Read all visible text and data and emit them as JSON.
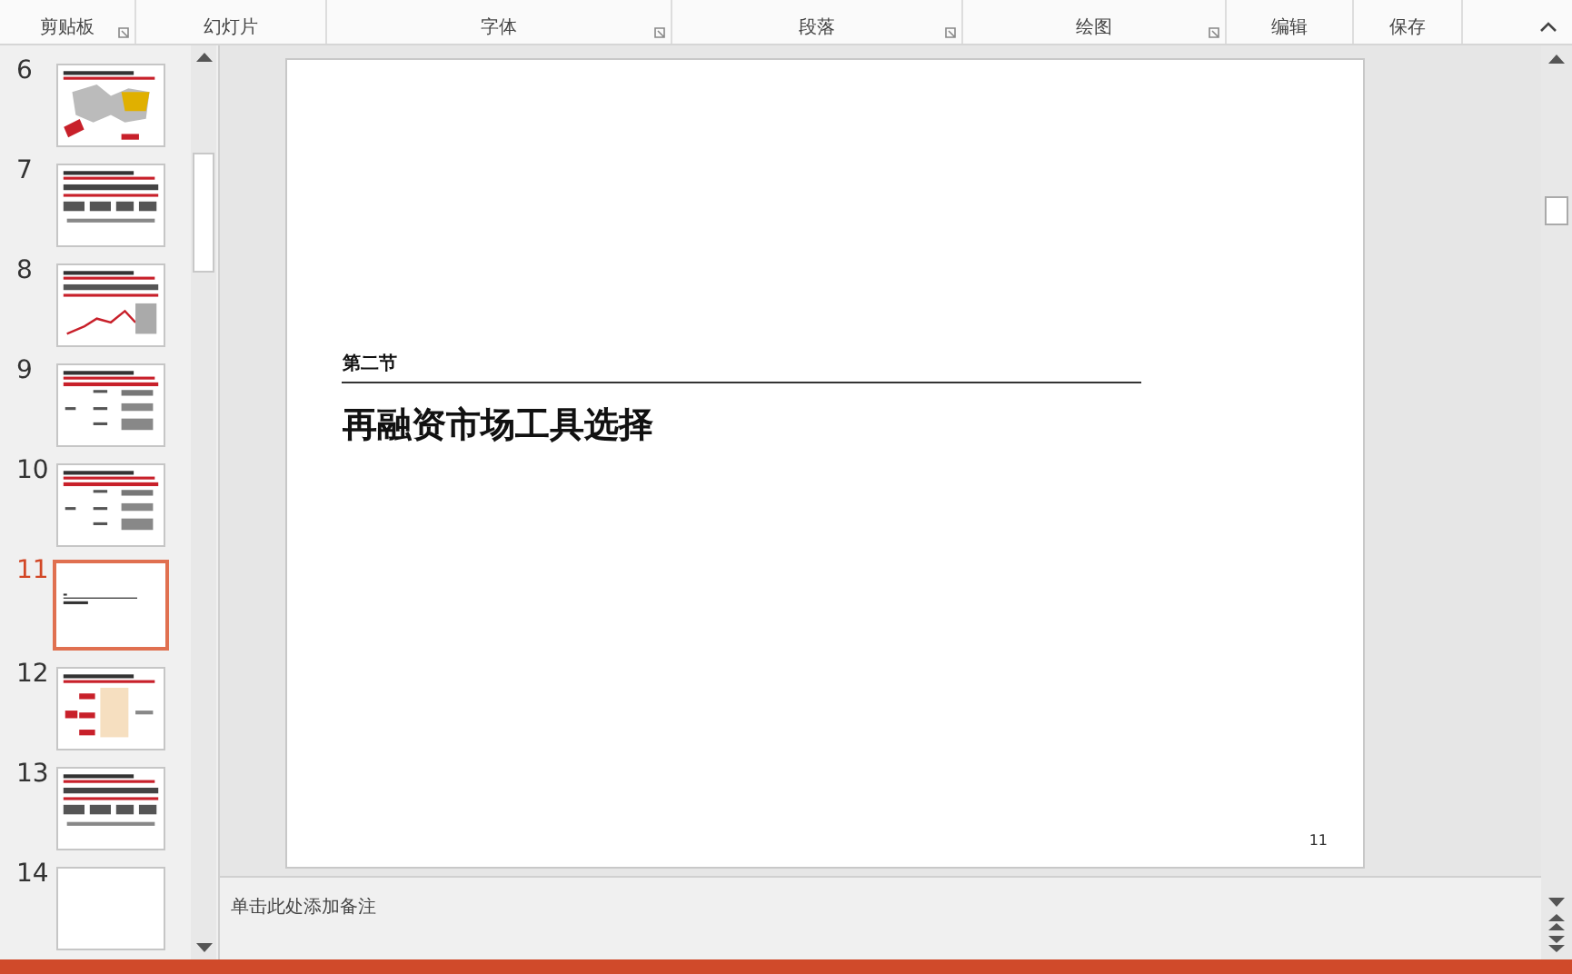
{
  "ribbon": {
    "groups": [
      {
        "label": "剪贴板",
        "launcher": true
      },
      {
        "label": "幻灯片",
        "launcher": false
      },
      {
        "label": "字体",
        "launcher": true
      },
      {
        "label": "段落",
        "launcher": true
      },
      {
        "label": "绘图",
        "launcher": true
      },
      {
        "label": "编辑",
        "launcher": false
      },
      {
        "label": "保存",
        "launcher": false
      }
    ]
  },
  "slides": [
    {
      "number": "6",
      "kind": "map",
      "selected": false
    },
    {
      "number": "7",
      "kind": "text",
      "selected": false
    },
    {
      "number": "8",
      "kind": "chart",
      "selected": false
    },
    {
      "number": "9",
      "kind": "table",
      "selected": false
    },
    {
      "number": "10",
      "kind": "table",
      "selected": false
    },
    {
      "number": "11",
      "kind": "title",
      "selected": true
    },
    {
      "number": "12",
      "kind": "flow",
      "selected": false
    },
    {
      "number": "13",
      "kind": "text",
      "selected": false
    },
    {
      "number": "14",
      "kind": "blank",
      "selected": false
    }
  ],
  "slide": {
    "section": "第二节",
    "title": "再融资市场工具选择",
    "page_number": "11"
  },
  "notes": {
    "placeholder": "单击此处添加备注"
  }
}
